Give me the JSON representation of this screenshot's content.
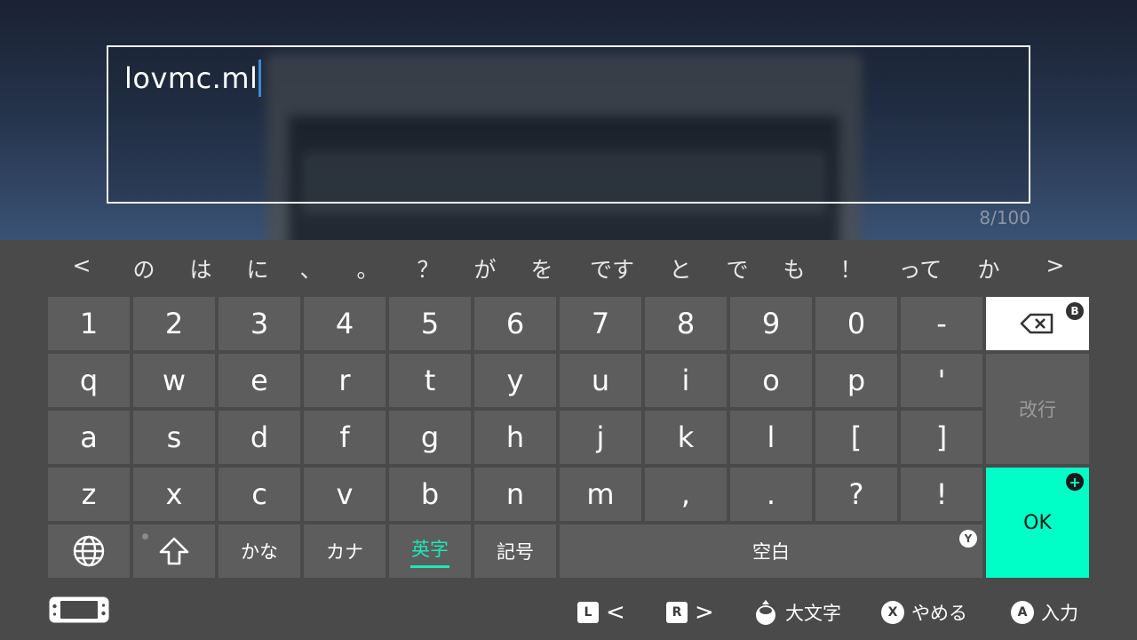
{
  "input": {
    "value": "lovmc.ml",
    "char_count": "8/100"
  },
  "suggestions": {
    "prev": "<",
    "next": ">",
    "items": [
      "の",
      "は",
      "に",
      "、",
      "。",
      "？",
      "が",
      "を",
      "です",
      "と",
      "で",
      "も",
      "！",
      "って",
      "か"
    ]
  },
  "keys": {
    "row1": [
      "1",
      "2",
      "3",
      "4",
      "5",
      "6",
      "7",
      "8",
      "9",
      "0",
      "-"
    ],
    "row2": [
      "q",
      "w",
      "e",
      "r",
      "t",
      "y",
      "u",
      "i",
      "o",
      "p",
      "'"
    ],
    "row3": [
      "a",
      "s",
      "d",
      "f",
      "g",
      "h",
      "j",
      "k",
      "l",
      "[",
      "]"
    ],
    "row4": [
      "z",
      "x",
      "c",
      "v",
      "b",
      "n",
      "m",
      ",",
      ".",
      "?",
      "!"
    ]
  },
  "modes": {
    "hiragana": "かな",
    "katakana": "カナ",
    "alphanumeric": "英字",
    "symbols": "記号",
    "active": "alphanumeric"
  },
  "side_keys": {
    "backspace_badge": "B",
    "newline": "改行",
    "ok": "OK",
    "ok_badge": "+",
    "space": "空白",
    "space_badge": "Y"
  },
  "footer": {
    "l_button": "L",
    "r_button": "R",
    "l_label": "<",
    "r_label": ">",
    "caps_label": "大文字",
    "cancel_button": "X",
    "cancel_label": "やめる",
    "confirm_button": "A",
    "confirm_label": "入力"
  },
  "colors": {
    "accent": "#00ffc6",
    "active_mode": "#1de9b6",
    "key_bg": "#5d5d5d",
    "panel_bg": "#4a4a4a",
    "caret": "#3a8bd8"
  }
}
